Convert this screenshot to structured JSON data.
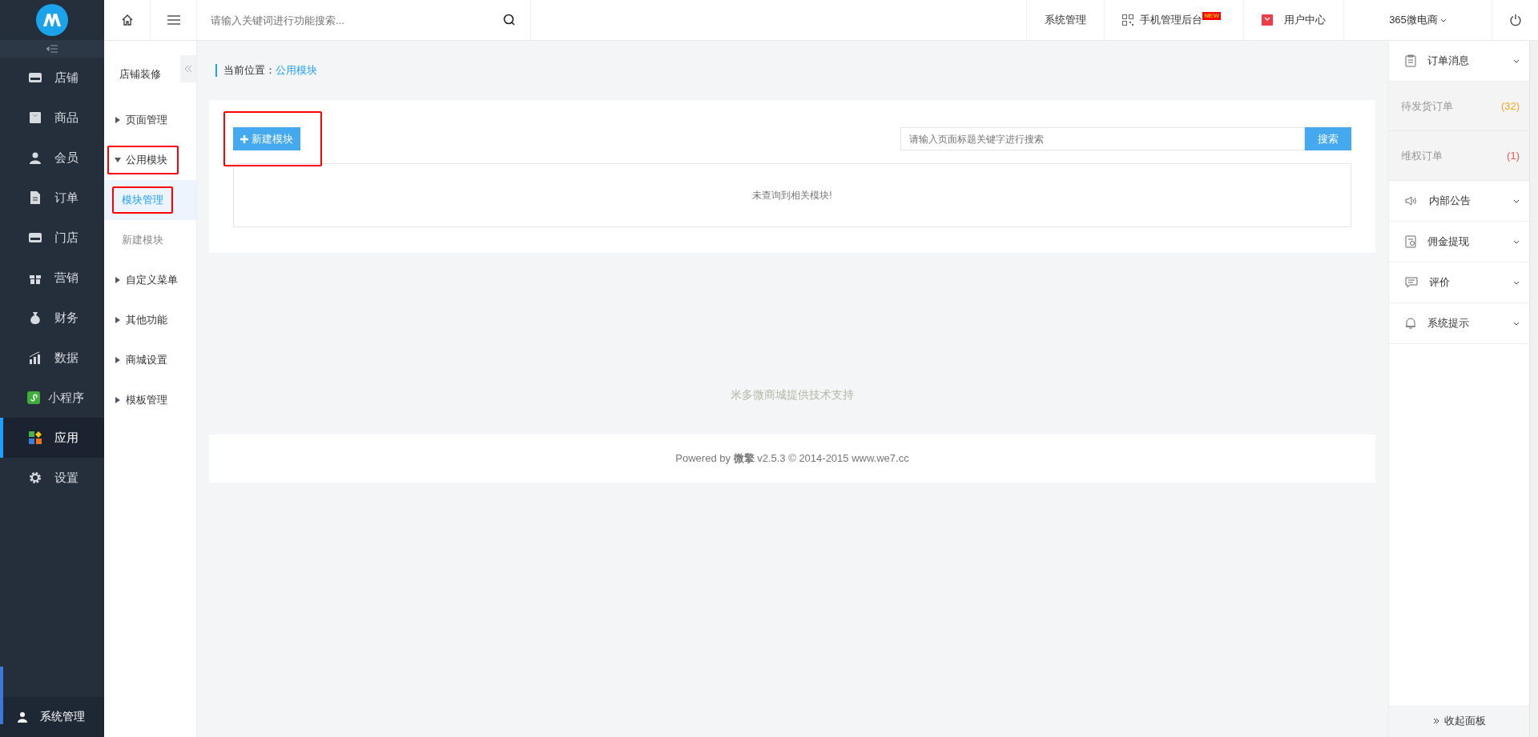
{
  "topbar": {
    "search": {
      "placeholder": "请输入关键词进行功能搜索..."
    },
    "links": [
      {
        "label": "系统管理",
        "kind": "text"
      },
      {
        "label": "手机管理后台",
        "kind": "qr",
        "badge": "NEW"
      },
      {
        "label": "用户中心",
        "kind": "bag"
      },
      {
        "label": "365微电商",
        "kind": "dropdown"
      }
    ]
  },
  "sidebar": {
    "items": [
      {
        "label": "店铺",
        "selected": false
      },
      {
        "label": "商品",
        "selected": false
      },
      {
        "label": "会员",
        "selected": false
      },
      {
        "label": "订单",
        "selected": false
      },
      {
        "label": "门店",
        "selected": false
      },
      {
        "label": "营销",
        "selected": false
      },
      {
        "label": "财务",
        "selected": false
      },
      {
        "label": "数据",
        "selected": false
      },
      {
        "label": "小程序",
        "selected": false
      },
      {
        "label": "应用",
        "selected": true
      },
      {
        "label": "设置",
        "selected": false
      }
    ],
    "footer": {
      "label": "系统管理"
    }
  },
  "submenu": {
    "title": "店铺装修",
    "items": [
      {
        "label": "页面管理",
        "expanded": false,
        "highlighted": false
      },
      {
        "label": "公用模块",
        "expanded": true,
        "highlighted": true,
        "children": [
          {
            "label": "模块管理",
            "selected": true,
            "highlighted": true
          },
          {
            "label": "新建模块",
            "selected": false,
            "highlighted": false
          }
        ]
      },
      {
        "label": "自定义菜单",
        "expanded": false,
        "highlighted": false
      },
      {
        "label": "其他功能",
        "expanded": false,
        "highlighted": false
      },
      {
        "label": "商城设置",
        "expanded": false,
        "highlighted": false
      },
      {
        "label": "模板管理",
        "expanded": false,
        "highlighted": false
      }
    ]
  },
  "breadcrumb": {
    "label": "当前位置：",
    "current": "公用模块"
  },
  "toolbar": {
    "new_button": {
      "label": "新建模块",
      "highlighted": true
    },
    "search": {
      "placeholder": "请输入页面标题关键字进行搜索"
    },
    "search_button": "搜索"
  },
  "empty_message": "未查询到相关模块!",
  "support_text": "米多微商城提供技术支持",
  "footer": "Powered by **微擎** v2.5.3 © 2014-2015 www.we7.cc",
  "right_panel": {
    "sections": [
      {
        "label": "订单消息",
        "children": [
          {
            "label": "待发货订单",
            "count": "(32)",
            "color": "#f5a623"
          },
          {
            "label": "维权订单",
            "count": "(1)",
            "color": "#e8555a"
          }
        ]
      },
      {
        "label": "内部公告"
      },
      {
        "label": "佣金提现"
      },
      {
        "label": "评价"
      },
      {
        "label": "系统提示"
      }
    ],
    "collapse": "收起面板"
  }
}
